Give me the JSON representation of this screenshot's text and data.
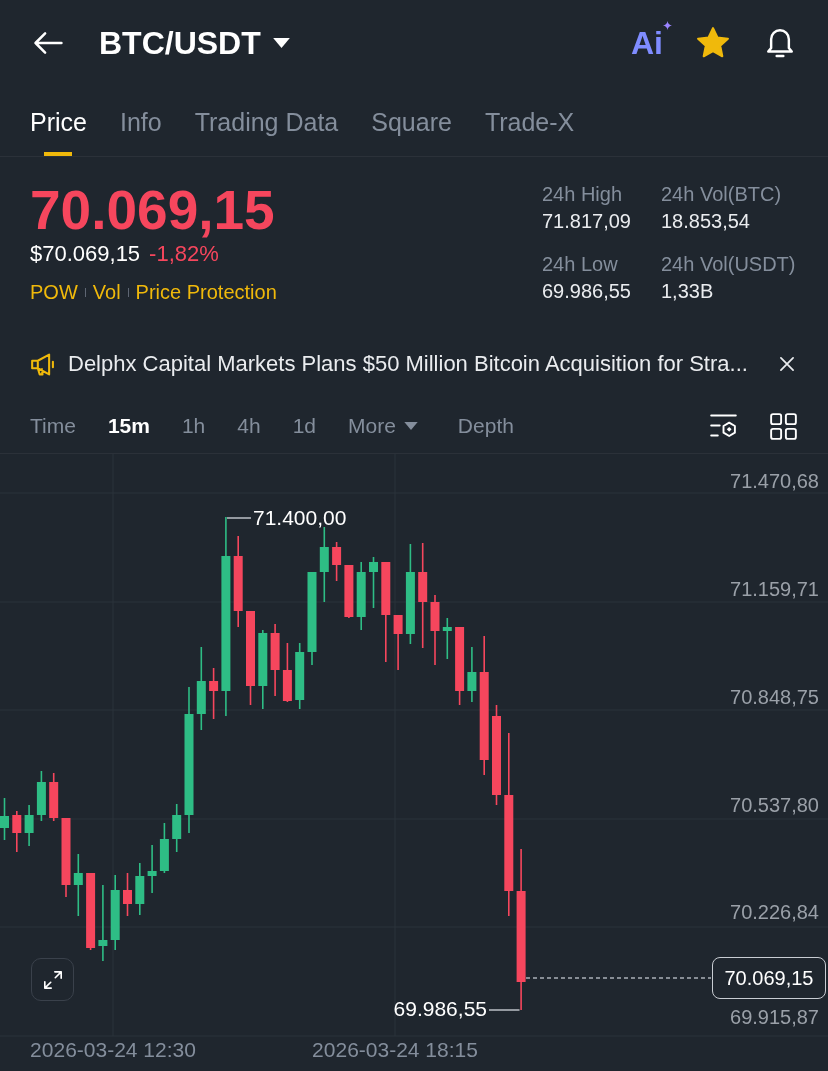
{
  "header": {
    "title": "BTC/USDT",
    "ai_label": "Ai",
    "favorite": true
  },
  "tabs": [
    {
      "label": "Price",
      "selected": true
    },
    {
      "label": "Info",
      "selected": false
    },
    {
      "label": "Trading Data",
      "selected": false
    },
    {
      "label": "Square",
      "selected": false
    },
    {
      "label": "Trade-X",
      "selected": false
    }
  ],
  "price": {
    "last": "70.069,15",
    "fiat": "$70.069,15",
    "change": "-1,82%",
    "falling": true,
    "tags": [
      "POW",
      "Vol",
      "Price Protection"
    ]
  },
  "stats": [
    {
      "label": "24h High",
      "value": "71.817,09"
    },
    {
      "label": "24h Vol(BTC)",
      "value": "18.853,54"
    },
    {
      "label": "24h Low",
      "value": "69.986,55"
    },
    {
      "label": "24h Vol(USDT)",
      "value": "1,33B"
    }
  ],
  "news": {
    "text": "Delphx Capital Markets Plans $50 Million Bitcoin Acquisition for Stra..."
  },
  "toolbar": {
    "items": [
      {
        "label": "Time",
        "selected": false,
        "kind": "option"
      },
      {
        "label": "15m",
        "selected": true,
        "kind": "option"
      },
      {
        "label": "1h",
        "selected": false,
        "kind": "option"
      },
      {
        "label": "4h",
        "selected": false,
        "kind": "option"
      },
      {
        "label": "1d",
        "selected": false,
        "kind": "option"
      },
      {
        "label": "More",
        "selected": false,
        "kind": "dropdown"
      },
      {
        "label": "Depth",
        "selected": false,
        "kind": "view"
      }
    ]
  },
  "chart": {
    "price_labels": [
      "71.470,68",
      "71.159,71",
      "70.848,75",
      "70.537,80",
      "70.226,84",
      "69.915,87"
    ],
    "time_labels": [
      "2026-03-24 12:30",
      "2026-03-24 18:15"
    ],
    "high_label": "71.400,00",
    "low_label": "69.986,55",
    "current_price": "70.069,15"
  }
}
